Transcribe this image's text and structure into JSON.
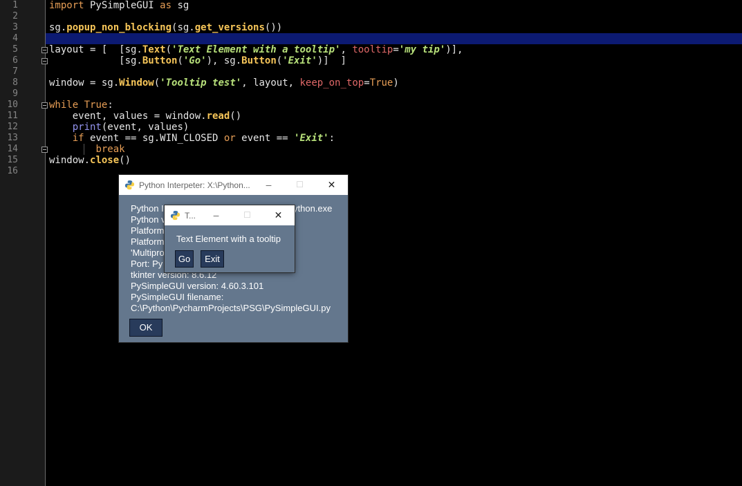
{
  "editor": {
    "line_numbers": [
      "1",
      "2",
      "3",
      "4",
      "5",
      "6",
      "7",
      "8",
      "9",
      "10",
      "11",
      "12",
      "13",
      "14",
      "15",
      "16"
    ],
    "code": {
      "l1": {
        "kw": "import",
        "a": " PySimpleGUI ",
        "kw2": "as",
        "b": " sg"
      },
      "l3": {
        "a": "sg.",
        "fn": "popup_non_blocking",
        "b": "(sg.",
        "fn2": "get_versions",
        "c": "())"
      },
      "l5": {
        "a": "layout = [  [sg.",
        "fn": "Text",
        "b": "(",
        "st": "'Text Element with a tooltip'",
        "c": ", ",
        "kwarg": "tooltip",
        "d": "=",
        "st2": "'my tip'",
        "e": ")],"
      },
      "l6": {
        "a": "            [sg.",
        "fn": "Button",
        "b": "(",
        "st": "'Go'",
        "c": "), sg.",
        "fn2": "Button",
        "d": "(",
        "st2": "'Exit'",
        "e": ")]  ]"
      },
      "l8": {
        "a": "window = sg.",
        "fn": "Window",
        "b": "(",
        "st": "'Tooltip test'",
        "c": ", layout, ",
        "kwarg": "keep_on_top",
        "d": "=",
        "kw": "True",
        "e": ")"
      },
      "l10": {
        "kw": "while",
        "a": " ",
        "kw2": "True",
        "b": ":"
      },
      "l11": {
        "a": "    event, values = window.",
        "fn": "read",
        "b": "()"
      },
      "l12": {
        "a": "    ",
        "bi": "print",
        "b": "(event, values)"
      },
      "l13": {
        "a": "    ",
        "kw": "if",
        "b": " event == sg.WIN_CLOSED ",
        "kw2": "or",
        "c": " event == ",
        "st": "'Exit'",
        "d": ":"
      },
      "l14": {
        "a": "        ",
        "kw": "break"
      },
      "l15": {
        "a": "window.",
        "fn": "close",
        "b": "()"
      }
    }
  },
  "popup": {
    "title": "Python Interpeter: X:\\Python...",
    "lines": [
      "Python I",
      "Python v",
      "Platform",
      "Platform",
      "'Multipro",
      "Port: Py",
      "tkinter version: 8.6.12",
      "PySimpleGUI version: 4.60.3.101",
      "PySimpleGUI filename:",
      "C:\\Python\\PycharmProjects\\PSG\\PySimpleGUI.py"
    ],
    "line1_tail": "ython.exe",
    "ok_label": "OK"
  },
  "tooltip_window": {
    "title": "T...",
    "text": "Text Element with a tooltip",
    "go_label": "Go",
    "exit_label": "Exit"
  },
  "controls": {
    "minimize": "–",
    "maximize": "☐",
    "close": "✕"
  },
  "colors": {
    "window_bg": "#64778d",
    "button_bg": "#283b5b",
    "current_line": "#0c1a72"
  }
}
